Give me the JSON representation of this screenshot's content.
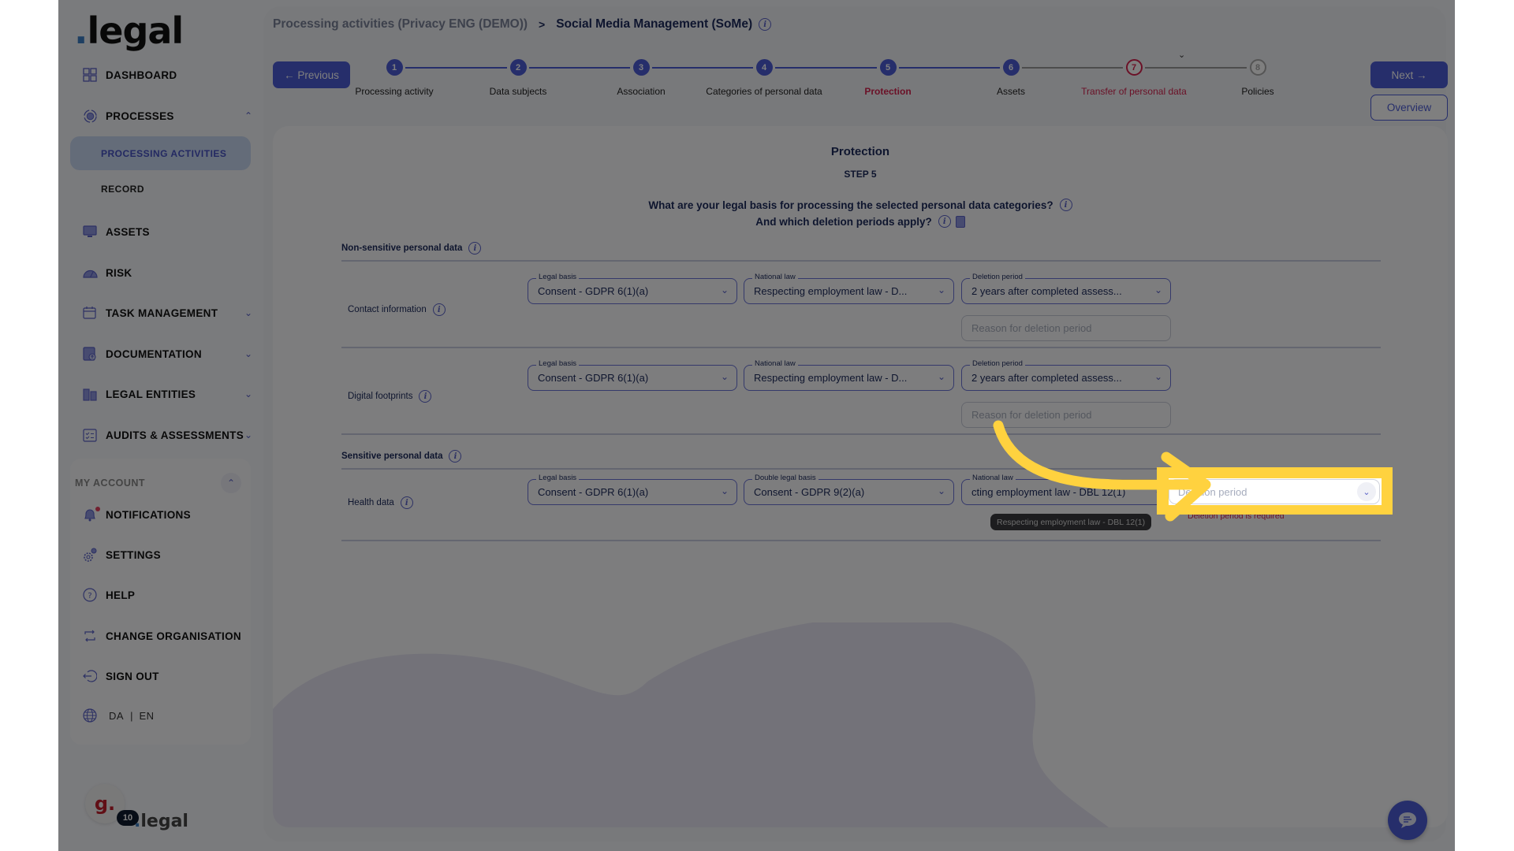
{
  "sidebar": {
    "logo": {
      "dot": ".",
      "text": "legal"
    },
    "items": [
      {
        "label": "DASHBOARD",
        "icon": "dashboard-grid-icon"
      },
      {
        "label": "PROCESSES",
        "icon": "processes-icon",
        "expanded": true
      },
      {
        "label": "ASSETS",
        "icon": "assets-icon"
      },
      {
        "label": "RISK",
        "icon": "risk-gauge-icon"
      },
      {
        "label": "TASK MANAGEMENT",
        "icon": "task-calendar-icon"
      },
      {
        "label": "DOCUMENTATION",
        "icon": "documentation-icon"
      },
      {
        "label": "LEGAL ENTITIES",
        "icon": "buildings-icon"
      },
      {
        "label": "AUDITS & ASSESSMENTS",
        "icon": "clipboard-checklist-icon"
      }
    ],
    "sub_items": [
      {
        "label": "PROCESSING ACTIVITIES",
        "active": true
      },
      {
        "label": "RECORD",
        "active": false
      }
    ],
    "account": {
      "header": "MY ACCOUNT",
      "items": [
        {
          "label": "NOTIFICATIONS",
          "icon": "bell-icon"
        },
        {
          "label": "SETTINGS",
          "icon": "gear-icon"
        },
        {
          "label": "HELP",
          "icon": "help-circle-icon"
        },
        {
          "label": "CHANGE ORGANISATION",
          "icon": "swap-icon"
        },
        {
          "label": "SIGN OUT",
          "icon": "sign-out-icon"
        }
      ],
      "languages": [
        "DA",
        "EN"
      ],
      "lang_separator": "|"
    },
    "footer": {
      "avatar_letter": "g.",
      "badge_count": "10",
      "logo_dot": ".",
      "logo_text": "legal"
    }
  },
  "header": {
    "breadcrumb_parent": "Processing activities (Privacy ENG (DEMO))",
    "breadcrumb_separator": ">",
    "breadcrumb_current": "Social Media Management (SoMe)",
    "previous_label": "← Previous",
    "next_label": "Next →",
    "overview_label": "Overview"
  },
  "stepper": {
    "current_step": 5,
    "steps": [
      {
        "number": "1",
        "label": "Processing activity",
        "state": "done"
      },
      {
        "number": "2",
        "label": "Data subjects",
        "state": "done"
      },
      {
        "number": "3",
        "label": "Association",
        "state": "done"
      },
      {
        "number": "4",
        "label": "Categories of personal data",
        "state": "done"
      },
      {
        "number": "5",
        "label": "Protection",
        "state": "active"
      },
      {
        "number": "6",
        "label": "Assets",
        "state": "done"
      },
      {
        "number": "7",
        "label": "Transfer of personal data",
        "state": "error"
      },
      {
        "number": "8",
        "label": "Policies",
        "state": "todo"
      }
    ]
  },
  "form": {
    "title": "Protection",
    "step": "STEP 5",
    "question_line1": "What are your legal basis for processing the selected personal data categories?",
    "question_line2": "And which deletion periods apply?",
    "non_sensitive_label": "Non-sensitive personal data",
    "sensitive_label": "Sensitive personal data",
    "rows": [
      {
        "category": "Contact information",
        "legal_basis_label": "Legal basis",
        "legal_basis": "Consent - GDPR 6(1)(a)",
        "national_law_label": "National law",
        "national_law": "Respecting employment law - D...",
        "deletion_label": "Deletion period",
        "deletion_period": "2 years after completed assess...",
        "reason_placeholder": "Reason for deletion period"
      },
      {
        "category": "Digital footprints",
        "legal_basis_label": "Legal basis",
        "legal_basis": "Consent - GDPR 6(1)(a)",
        "national_law_label": "National law",
        "national_law": "Respecting employment law - D...",
        "deletion_label": "Deletion period",
        "deletion_period": "2 years after completed assess...",
        "reason_placeholder": "Reason for deletion period"
      }
    ],
    "sensitive_rows": [
      {
        "category": "Health data",
        "legal_basis_label": "Legal basis",
        "legal_basis": "Consent - GDPR 6(1)(a)",
        "double_legal_basis_label": "Double legal basis",
        "double_legal_basis": "Consent - GDPR 9(2)(a)",
        "national_law_label": "National law",
        "national_law": "cting employment law - DBL 12(1)",
        "national_law_tooltip": "Respecting employment law - DBL 12(1)",
        "deletion_placeholder": "Deletion period",
        "deletion_error": "Deletion period is required"
      }
    ]
  },
  "colors": {
    "accent": "#4c5cd6",
    "navy": "#1d2a5c",
    "error": "#d6234f",
    "highlight": "#ffd23f"
  }
}
